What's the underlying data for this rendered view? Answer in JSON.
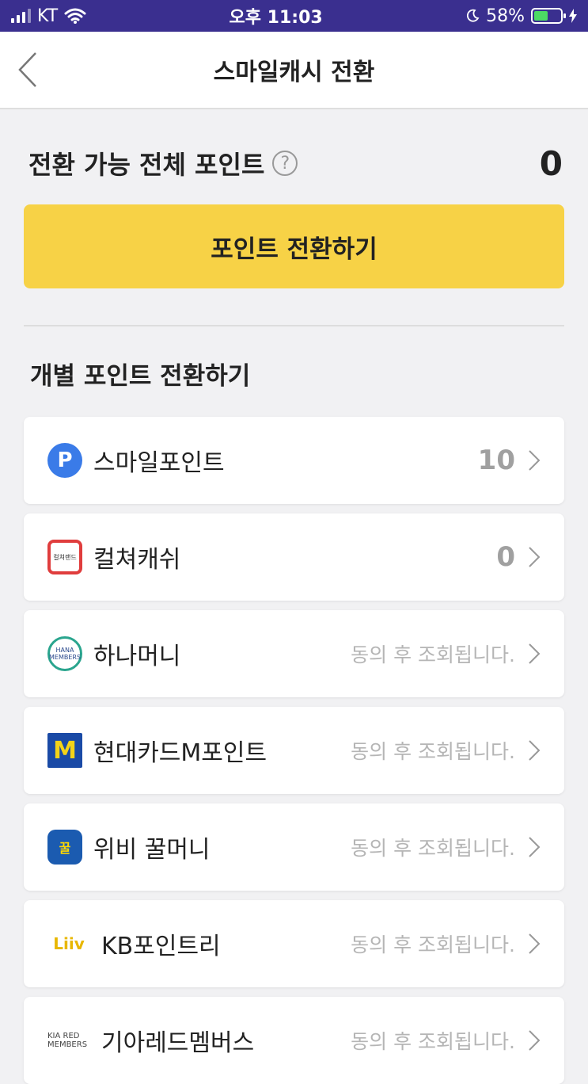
{
  "status_bar": {
    "carrier": "KT",
    "time": "오후 11:03",
    "battery_text": "58%",
    "battery_level": 0.58,
    "battery_color": "#4cd964",
    "bar_color": "#3a2f8f"
  },
  "nav": {
    "title": "스마일캐시 전환",
    "back_icon": "chevron-left-icon"
  },
  "summary": {
    "label": "전환 가능 전체 포인트",
    "help": "?",
    "value": "0"
  },
  "convert_all": {
    "label": "포인트 전환하기",
    "color": "#f7d246"
  },
  "section": {
    "title": "개별 포인트 전환하기"
  },
  "items": [
    {
      "name": "스마일포인트",
      "value": "10",
      "logo": "smile-point-logo",
      "logo_text": "P"
    },
    {
      "name": "컬쳐캐쉬",
      "value": "0",
      "logo": "culture-land-logo",
      "logo_text": "컬쳐랜드"
    },
    {
      "name": "하나머니",
      "status": "동의 후 조회됩니다.",
      "logo": "hana-members-logo",
      "logo_text": "HANA MEMBERS"
    },
    {
      "name": "현대카드M포인트",
      "status": "동의 후 조회됩니다.",
      "logo": "hyundai-card-m-logo",
      "logo_text": "M"
    },
    {
      "name": "위비 꿀머니",
      "status": "동의 후 조회됩니다.",
      "logo": "wibee-money-logo",
      "logo_text": "꿀"
    },
    {
      "name": "KB포인트리",
      "status": "동의 후 조회됩니다.",
      "logo": "liiv-logo",
      "logo_text": "Liiv"
    },
    {
      "name": "기아레드멤버스",
      "status": "동의 후 조회됩니다.",
      "logo": "kia-red-members-logo",
      "logo_text": "KIA RED MEMBERS"
    }
  ]
}
